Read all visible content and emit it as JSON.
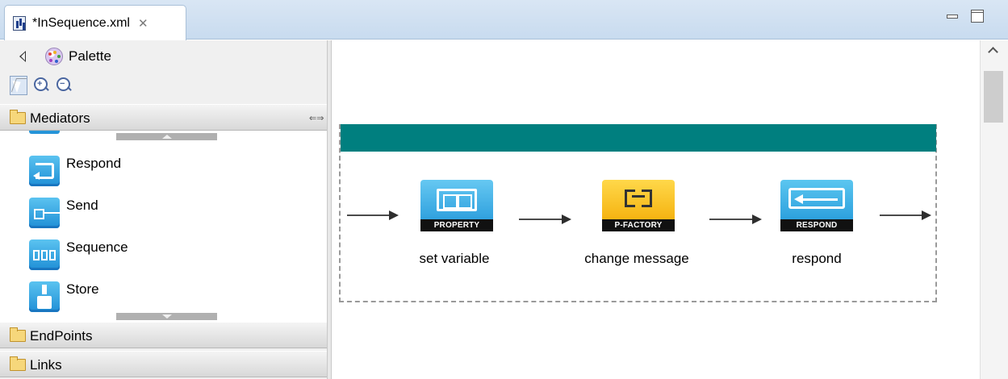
{
  "editor_tab": {
    "title": "*InSequence.xml",
    "close": "✕"
  },
  "palette": {
    "title": "Palette",
    "drawers": [
      {
        "label": "Mediators"
      },
      {
        "label": "EndPoints"
      },
      {
        "label": "Links"
      }
    ],
    "mediators": [
      {
        "label": "Respond",
        "icon": "respond-icon"
      },
      {
        "label": "Send",
        "icon": "send-icon"
      },
      {
        "label": "Sequence",
        "icon": "sequence-icon"
      },
      {
        "label": "Store",
        "icon": "store-icon"
      }
    ]
  },
  "canvas": {
    "nodes": [
      {
        "badge": "PROPERTY",
        "caption": "set variable"
      },
      {
        "badge": "P-FACTORY",
        "caption": "change message"
      },
      {
        "badge": "RESPOND",
        "caption": "respond"
      }
    ],
    "colors": {
      "sequence_bar": "#007f7f",
      "property": "#1f95d8",
      "payload_factory": "#f2a800",
      "respond": "#1f95d8"
    }
  }
}
